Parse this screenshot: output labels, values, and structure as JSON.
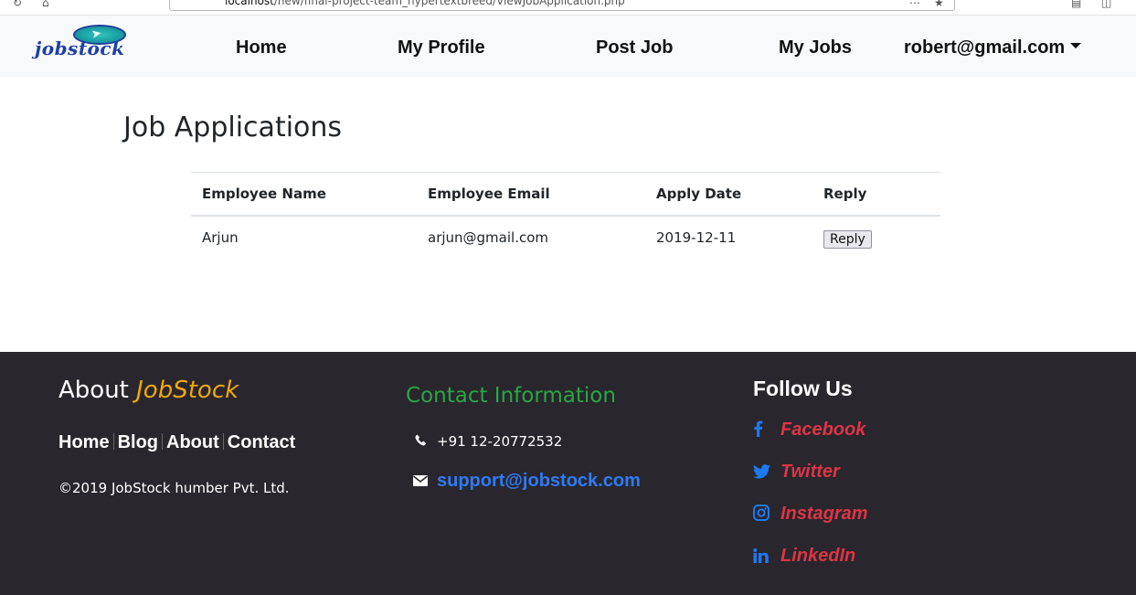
{
  "browser": {
    "url_host": "localhost",
    "url_path": "/new/final-project-team_hypertextbreed/ViewJobApplication.php"
  },
  "navbar": {
    "logo_text": "jobstock",
    "items": [
      {
        "label": "Home"
      },
      {
        "label": "My Profile"
      },
      {
        "label": "Post Job"
      },
      {
        "label": "My Jobs"
      }
    ],
    "user_menu": "robert@gmail.com"
  },
  "main": {
    "title": "Job Applications",
    "table": {
      "headers": [
        "Employee Name",
        "Employee Email",
        "Apply Date",
        "Reply"
      ],
      "rows": [
        {
          "name": "Arjun",
          "email": "arjun@gmail.com",
          "date": "2019-12-11",
          "action": "Reply"
        }
      ]
    }
  },
  "footer": {
    "about": {
      "prefix": "About",
      "brand": "JobStock"
    },
    "links": [
      "Home",
      "Blog",
      "About",
      "Contact"
    ],
    "copyright": "©2019 JobStock humber Pvt. Ltd.",
    "contact": {
      "heading": "Contact Information",
      "phone": "+91 12-20772532",
      "email": "support@jobstock.com"
    },
    "follow": {
      "heading": "Follow Us",
      "items": [
        {
          "label": "Facebook",
          "icon": "facebook-icon"
        },
        {
          "label": "Twitter",
          "icon": "twitter-icon"
        },
        {
          "label": "Instagram",
          "icon": "instagram-icon"
        },
        {
          "label": "LinkedIn",
          "icon": "linkedin-icon"
        }
      ]
    }
  },
  "colors": {
    "navbar_bg": "#f8f9fa",
    "footer_bg": "#29262d",
    "brand_accent": "#f0a90a",
    "contact_heading": "#28a745",
    "email_link": "#2e7bf5",
    "social_label": "#dc3545",
    "social_icon": "#1d7af3"
  }
}
